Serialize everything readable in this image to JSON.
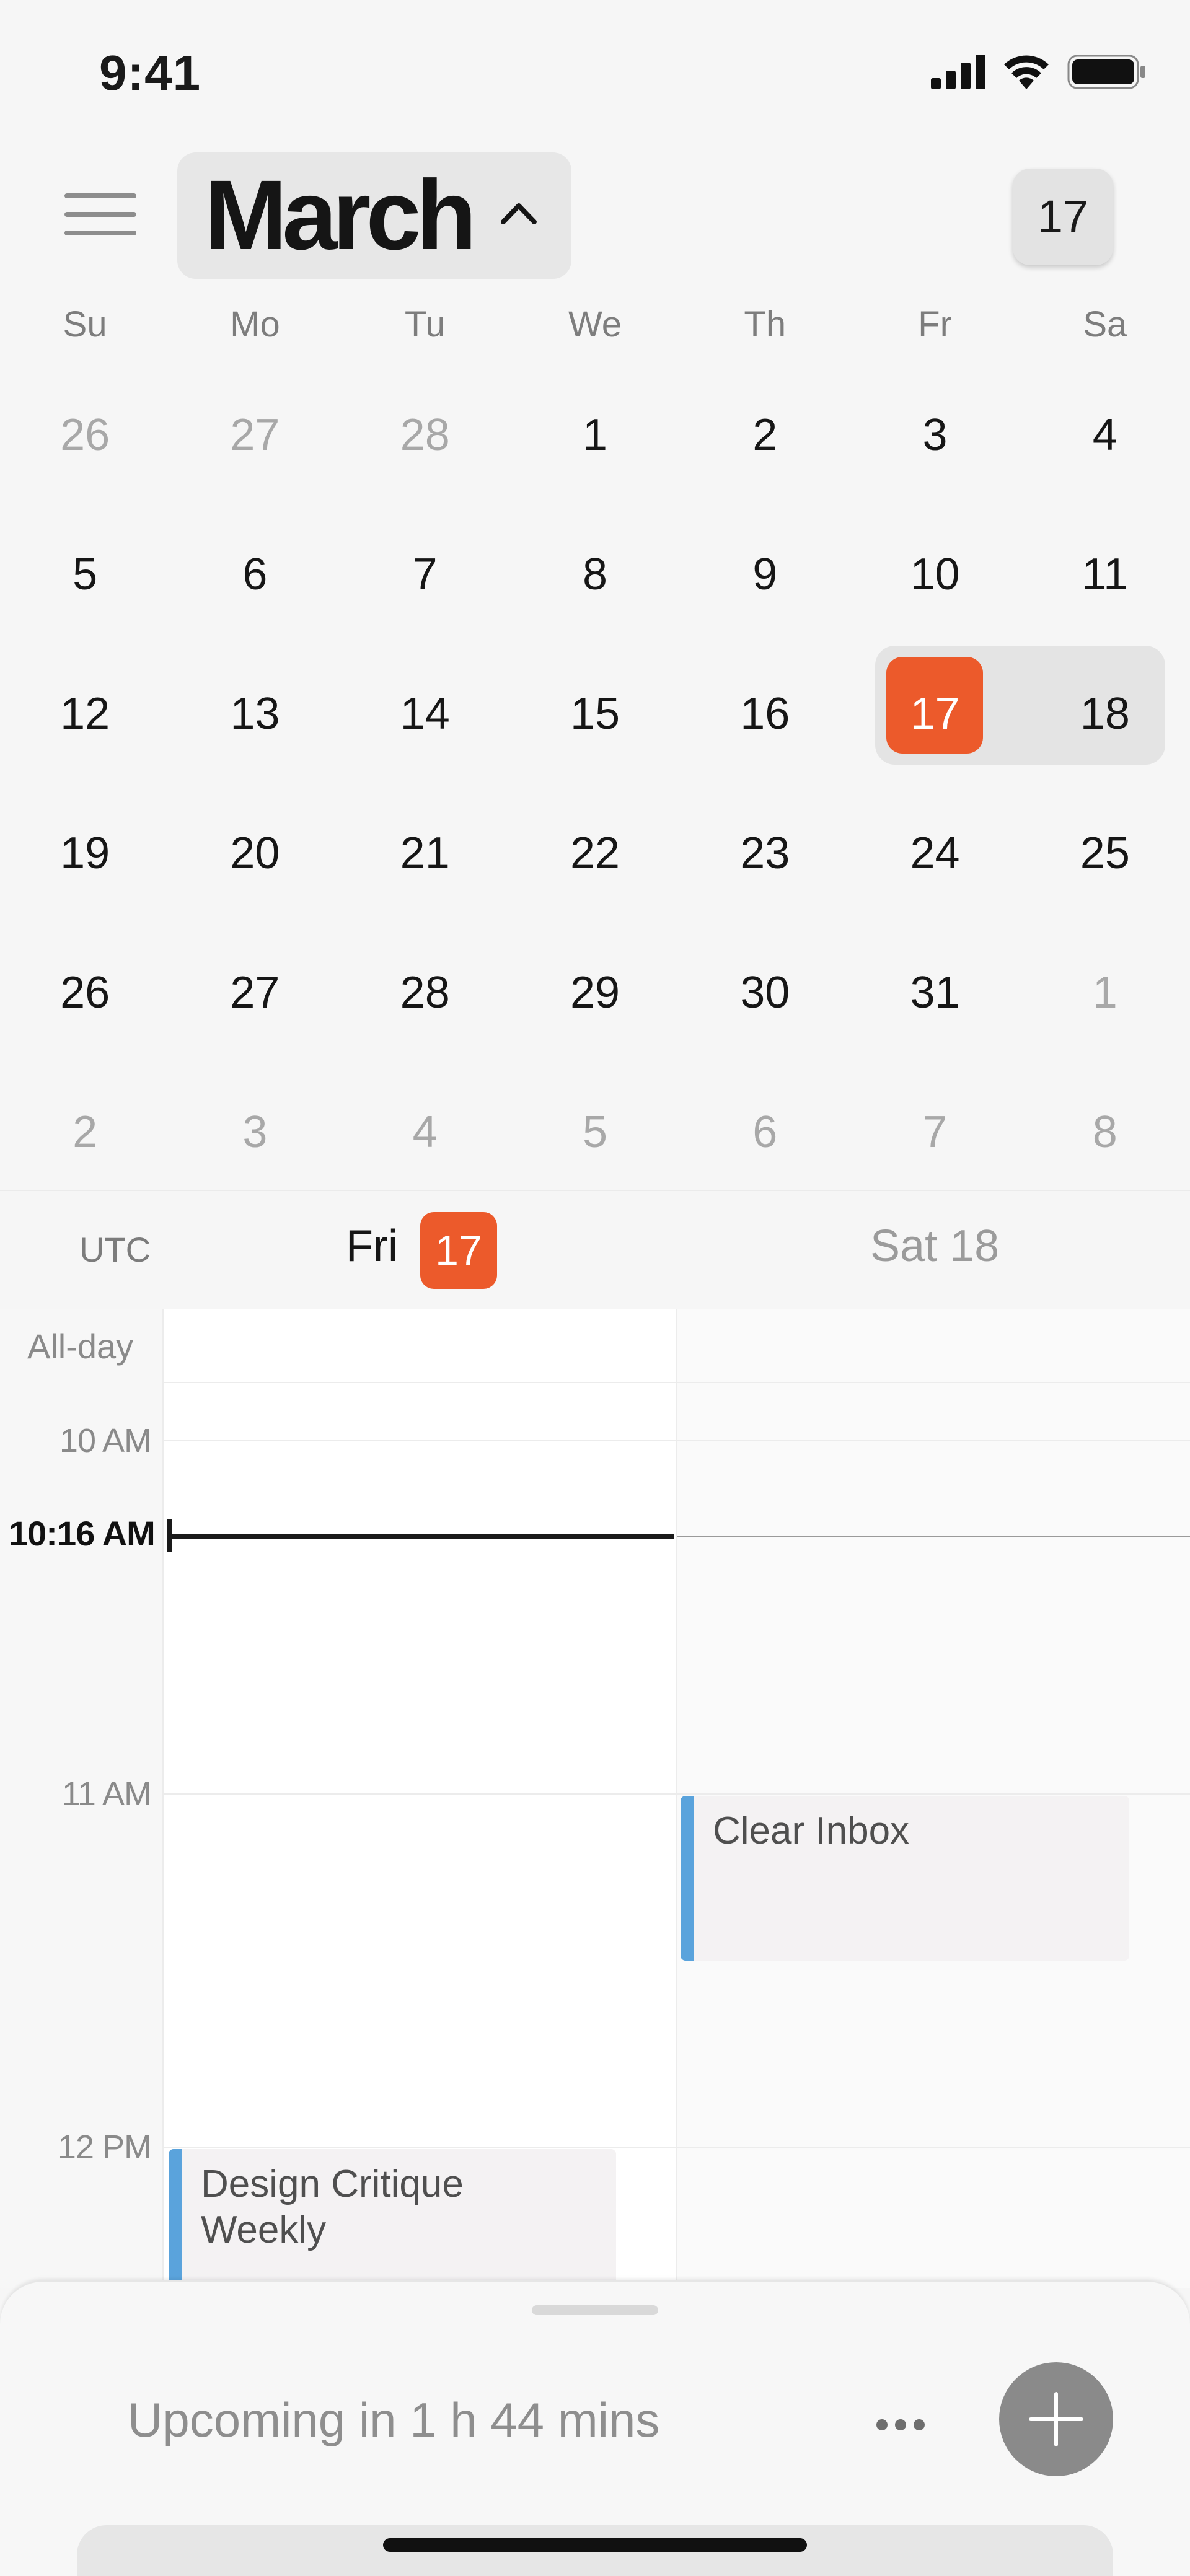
{
  "status_bar": {
    "time": "9:41"
  },
  "header": {
    "month": "March",
    "today_button": "17"
  },
  "weekdays": [
    "Su",
    "Mo",
    "Tu",
    "We",
    "Th",
    "Fr",
    "Sa"
  ],
  "weeks": [
    [
      {
        "d": "26",
        "m": true
      },
      {
        "d": "27",
        "m": true
      },
      {
        "d": "28",
        "m": true
      },
      {
        "d": "1"
      },
      {
        "d": "2"
      },
      {
        "d": "3"
      },
      {
        "d": "4"
      }
    ],
    [
      {
        "d": "5"
      },
      {
        "d": "6"
      },
      {
        "d": "7"
      },
      {
        "d": "8"
      },
      {
        "d": "9"
      },
      {
        "d": "10"
      },
      {
        "d": "11"
      }
    ],
    [
      {
        "d": "12"
      },
      {
        "d": "13"
      },
      {
        "d": "14"
      },
      {
        "d": "15"
      },
      {
        "d": "16"
      },
      {
        "d": "17",
        "today": true
      },
      {
        "d": "18"
      }
    ],
    [
      {
        "d": "19"
      },
      {
        "d": "20"
      },
      {
        "d": "21"
      },
      {
        "d": "22"
      },
      {
        "d": "23"
      },
      {
        "d": "24"
      },
      {
        "d": "25"
      }
    ],
    [
      {
        "d": "26"
      },
      {
        "d": "27"
      },
      {
        "d": "28"
      },
      {
        "d": "29"
      },
      {
        "d": "30"
      },
      {
        "d": "31"
      },
      {
        "d": "1",
        "m": true
      }
    ],
    [
      {
        "d": "2",
        "m": true
      },
      {
        "d": "3",
        "m": true
      },
      {
        "d": "4",
        "m": true
      },
      {
        "d": "5",
        "m": true
      },
      {
        "d": "6",
        "m": true
      },
      {
        "d": "7",
        "m": true
      },
      {
        "d": "8",
        "m": true
      }
    ]
  ],
  "day_header": {
    "tz": "UTC",
    "day1_name": "Fri",
    "day1_num": "17",
    "day2": "Sat 18"
  },
  "timeline": {
    "allday": "All-day",
    "hours": [
      "10 AM",
      "11 AM",
      "12 PM"
    ],
    "now": "10:16 AM",
    "events": [
      {
        "title": "Clear Inbox"
      },
      {
        "title": "Design Critique Weekly"
      }
    ]
  },
  "sheet": {
    "upcoming": "Upcoming in 1 h 44 mins"
  },
  "colors": {
    "accent": "#ec5a2b",
    "event_bar": "#5aa3dc"
  }
}
